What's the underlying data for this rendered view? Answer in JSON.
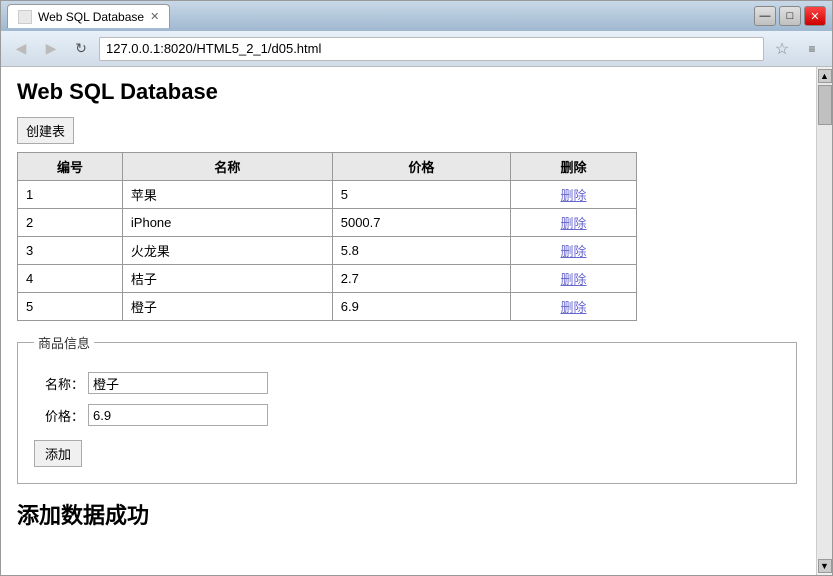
{
  "browser": {
    "tab_title": "Web SQL Database",
    "url": "127.0.0.1:8020/HTML5_2_1/d05.html",
    "back_btn": "◀",
    "forward_btn": "▶",
    "refresh_btn": "↻",
    "star_btn": "☆",
    "menu_btn": "≡",
    "close_btn": "✕",
    "minimize_btn": "—",
    "maximize_btn": "□"
  },
  "page": {
    "title": "Web SQL Database",
    "create_table_btn": "创建表",
    "table": {
      "headers": [
        "编号",
        "名称",
        "价格",
        "删除"
      ],
      "rows": [
        {
          "id": "1",
          "name": "苹果",
          "price": "5",
          "delete": "删除"
        },
        {
          "id": "2",
          "name": "iPhone",
          "price": "5000.7",
          "delete": "删除"
        },
        {
          "id": "3",
          "name": "火龙果",
          "price": "5.8",
          "delete": "删除"
        },
        {
          "id": "4",
          "name": "桔子",
          "price": "2.7",
          "delete": "删除"
        },
        {
          "id": "5",
          "name": "橙子",
          "price": "6.9",
          "delete": "删除"
        }
      ]
    },
    "form": {
      "legend": "商品信息",
      "name_label": "名称：",
      "name_value": "橙子",
      "price_label": "价格：",
      "price_value": "6.9",
      "add_btn": "添加"
    },
    "success_message": "添加数据成功"
  }
}
